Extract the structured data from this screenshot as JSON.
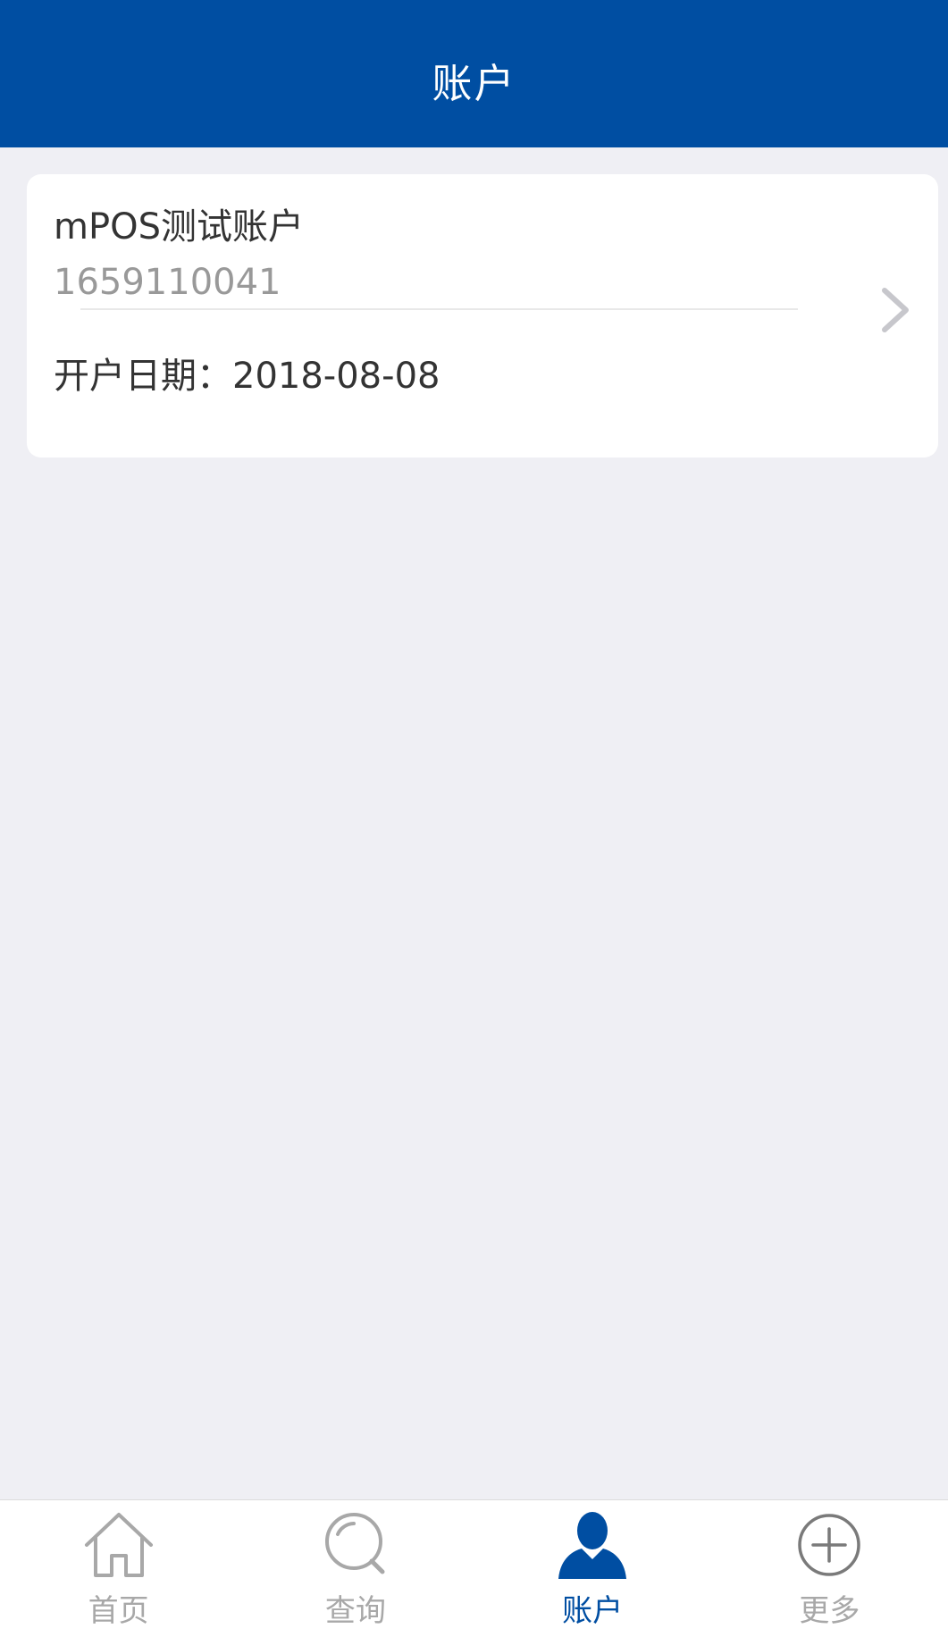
{
  "header": {
    "title": "账户"
  },
  "account": {
    "name": "mPOS测试账户",
    "number": "1659110041",
    "open_date_label": "开户日期：",
    "open_date": "2018-08-08"
  },
  "tabs": [
    {
      "label": "首页",
      "icon": "home-icon",
      "active": false
    },
    {
      "label": "查询",
      "icon": "search-icon",
      "active": false
    },
    {
      "label": "账户",
      "icon": "user-icon",
      "active": true
    },
    {
      "label": "更多",
      "icon": "plus-circle-icon",
      "active": false
    }
  ],
  "colors": {
    "primary": "#004ea2",
    "background": "#efeff4",
    "inactive": "#a8a8a8",
    "card": "#ffffff"
  }
}
